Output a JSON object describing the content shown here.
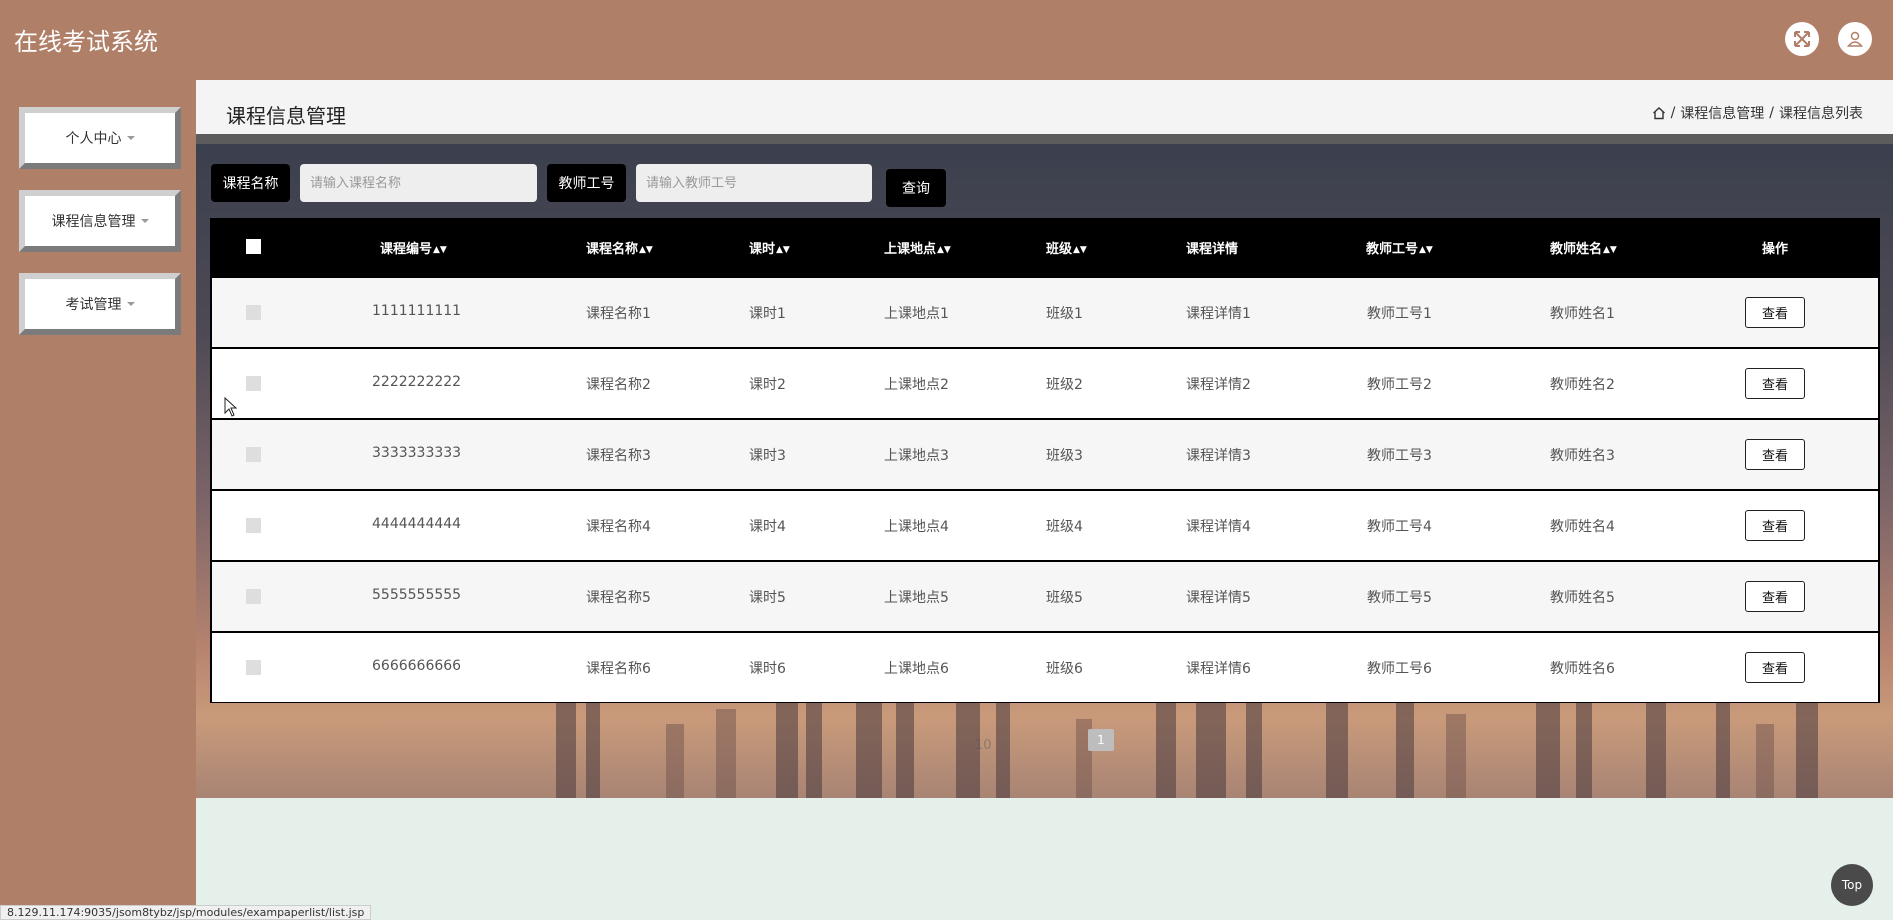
{
  "app": {
    "title": "在线考试系统"
  },
  "sidebar": {
    "items": [
      {
        "label": "个人中心"
      },
      {
        "label": "课程信息管理"
      },
      {
        "label": "考试管理"
      }
    ]
  },
  "page": {
    "title": "课程信息管理",
    "breadcrumb": [
      "课程信息管理",
      "课程信息列表"
    ]
  },
  "search": {
    "course_name_label": "课程名称",
    "course_name_placeholder": "请输入课程名称",
    "teacher_id_label": "教师工号",
    "teacher_id_placeholder": "请输入教师工号",
    "query_label": "查询"
  },
  "table": {
    "columns": [
      "课程编号",
      "课程名称",
      "课时",
      "上课地点",
      "班级",
      "课程详情",
      "教师工号",
      "教师姓名",
      "操作"
    ],
    "rows": [
      [
        "1111111111",
        "课程名称1",
        "课时1",
        "上课地点1",
        "班级1",
        "课程详情1",
        "教师工号1",
        "教师姓名1"
      ],
      [
        "2222222222",
        "课程名称2",
        "课时2",
        "上课地点2",
        "班级2",
        "课程详情2",
        "教师工号2",
        "教师姓名2"
      ],
      [
        "3333333333",
        "课程名称3",
        "课时3",
        "上课地点3",
        "班级3",
        "课程详情3",
        "教师工号3",
        "教师姓名3"
      ],
      [
        "4444444444",
        "课程名称4",
        "课时4",
        "上课地点4",
        "班级4",
        "课程详情4",
        "教师工号4",
        "教师姓名4"
      ],
      [
        "5555555555",
        "课程名称5",
        "课时5",
        "上课地点5",
        "班级5",
        "课程详情5",
        "教师工号5",
        "教师姓名5"
      ],
      [
        "6666666666",
        "课程名称6",
        "课时6",
        "上课地点6",
        "班级6",
        "课程详情6",
        "教师工号6",
        "教师姓名6"
      ]
    ],
    "action_label": "查看"
  },
  "pagination": {
    "page_size": "10",
    "current_page": "1"
  },
  "back_to_top": "Top",
  "statusbar": {
    "url": "8.129.11.174:9035/jsom8tybz/jsp/modules/exampaperlist/list.jsp"
  },
  "colors": {
    "header": "#b07f68",
    "table": "#000000",
    "content_bg": "#e6f0eb"
  }
}
